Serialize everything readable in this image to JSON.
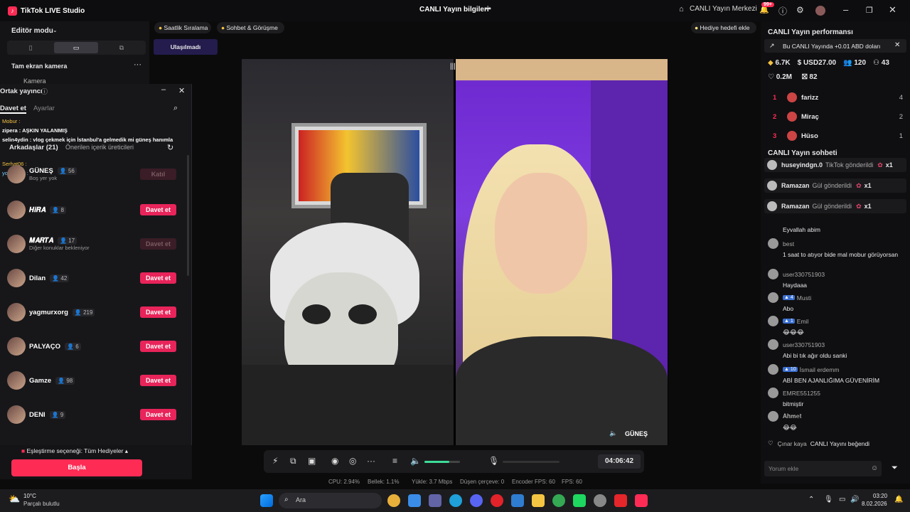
{
  "app": {
    "title": "TikTok LIVE Studio",
    "center_title": "CANLI Yayın bilgileri",
    "center_btn": "CANLI Yayın Merkezi",
    "notif_count": "99+"
  },
  "left": {
    "mode": "Editör modu",
    "camera_section": "Tam ekran kamera",
    "camera_item": "Kamera"
  },
  "popup": {
    "title": "Ortak yayıncı",
    "tabs": [
      "Davet et",
      "Ayarlar"
    ],
    "friends": "Arkadaşlar (21)",
    "suggested": "Önerilen içerik üreticileri",
    "overlay_chat": [
      "Mobur :",
      "zipera : AŞKIN YALANMIŞ",
      "selin4ydin : vlog çekmek için İstanbul'a gelmedik mi güneş hanımla",
      "Serhat06 :",
      "yozdek57 :"
    ],
    "rows": [
      {
        "name": "GÜNEŞ",
        "count": "56",
        "btn": "Katıl",
        "sub": "Boş yer yok",
        "dis": true
      },
      {
        "name": "𝑯𝒊𝑹𝑨",
        "count": "8",
        "btn": "Davet et",
        "sub": "",
        "dis": false
      },
      {
        "name": "𝑴𝑨𝑹𝑻𝑨",
        "count": "17",
        "btn": "Davet et",
        "sub": "Diğer konuklar bekleniyor",
        "dis": true
      },
      {
        "name": "Dilan",
        "count": "42",
        "btn": "Davet et",
        "sub": "",
        "dis": false
      },
      {
        "name": "yagmurxorg",
        "count": "219",
        "btn": "Davet et",
        "sub": "",
        "dis": false
      },
      {
        "name": "PALYAÇO",
        "count": "6",
        "btn": "Davet et",
        "sub": "",
        "dis": false
      },
      {
        "name": "Gamze",
        "count": "98",
        "btn": "Davet et",
        "sub": "",
        "dis": false
      },
      {
        "name": "DENI",
        "count": "9",
        "btn": "Davet et",
        "sub": "",
        "dis": false
      }
    ],
    "match": "Eşleştirme seçeneği: Tüm Hediyeler",
    "start": "Başla"
  },
  "top_pills": {
    "hourly": "Saatlik Sıralama",
    "chat": "Sohbet & Görüşme",
    "status": "Ulaşılmadı",
    "gift_goal": "Hediye hedefi ekle"
  },
  "stage": {
    "guest_name": "GÜNEŞ"
  },
  "controls": {
    "timer": "04:06:42",
    "volume": 0.7
  },
  "stats": {
    "cpu": "CPU: 2.94%",
    "mem": "Bellek: 1.1%",
    "upload": "Yükle: 3.7 Mbps",
    "drop": "Düşen çerçeve: 0",
    "enc": "Encoder FPS: 60",
    "fps": "FPS: 60"
  },
  "perf": {
    "title": "CANLI Yayın performansı",
    "banner": "Bu CANLI Yayında +0.01 ABD doları",
    "diamonds": "6.7K",
    "usd": "USD27.00",
    "viewers": "120",
    "followers": "43",
    "likes": "0.2M",
    "gifters": "82"
  },
  "ranks": [
    {
      "n": "1",
      "name": "farizz",
      "v": "4"
    },
    {
      "n": "2",
      "name": "Miraç",
      "v": "2"
    },
    {
      "n": "3",
      "name": "Hüso",
      "v": "1"
    }
  ],
  "chat": {
    "title": "CANLI Yayın sohbeti",
    "gifts": [
      {
        "user": "huseyindgn.0",
        "txt": "TikTok gönderildi",
        "x": "x1"
      },
      {
        "user": "Ramazan",
        "txt": "Gül gönderildi",
        "x": "x1"
      },
      {
        "user": "Ramazan",
        "txt": "Gül gönderildi",
        "x": "x1"
      }
    ],
    "msgs": [
      {
        "user": "",
        "text": "Eyvallah abim",
        "lvl": ""
      },
      {
        "user": "best",
        "text": "1 saat to atıyor bide mal mobur görüyorsan",
        "lvl": ""
      },
      {
        "user": "user330751903",
        "text": "Haydaaa",
        "lvl": ""
      },
      {
        "user": "Musti",
        "text": "Abo",
        "lvl": "4"
      },
      {
        "user": "Emil",
        "text": "😂😂😂",
        "lvl": "1"
      },
      {
        "user": "user330751903",
        "text": "Abi bi tık ağır oldu sanki",
        "lvl": ""
      },
      {
        "user": "İsmail erdemm",
        "text": "ABİ BEN AJANLIĞIMA GÜVENİRİM",
        "lvl": "10"
      },
      {
        "user": "EMRE551255",
        "text": "bitmiştir",
        "lvl": ""
      },
      {
        "user": "𝐀𝐡𝐦𝐞𝐭",
        "text": "😂😂",
        "lvl": ""
      }
    ],
    "liked_user": "Çınar kaya",
    "liked_text": "CANLI Yayını beğendi",
    "placeholder": "Yorum ekle"
  },
  "taskbar": {
    "temp": "10°C",
    "weather": "Parçalı bulutlu",
    "search": "Ara",
    "time": "03:20",
    "date": "8.02.2026"
  }
}
